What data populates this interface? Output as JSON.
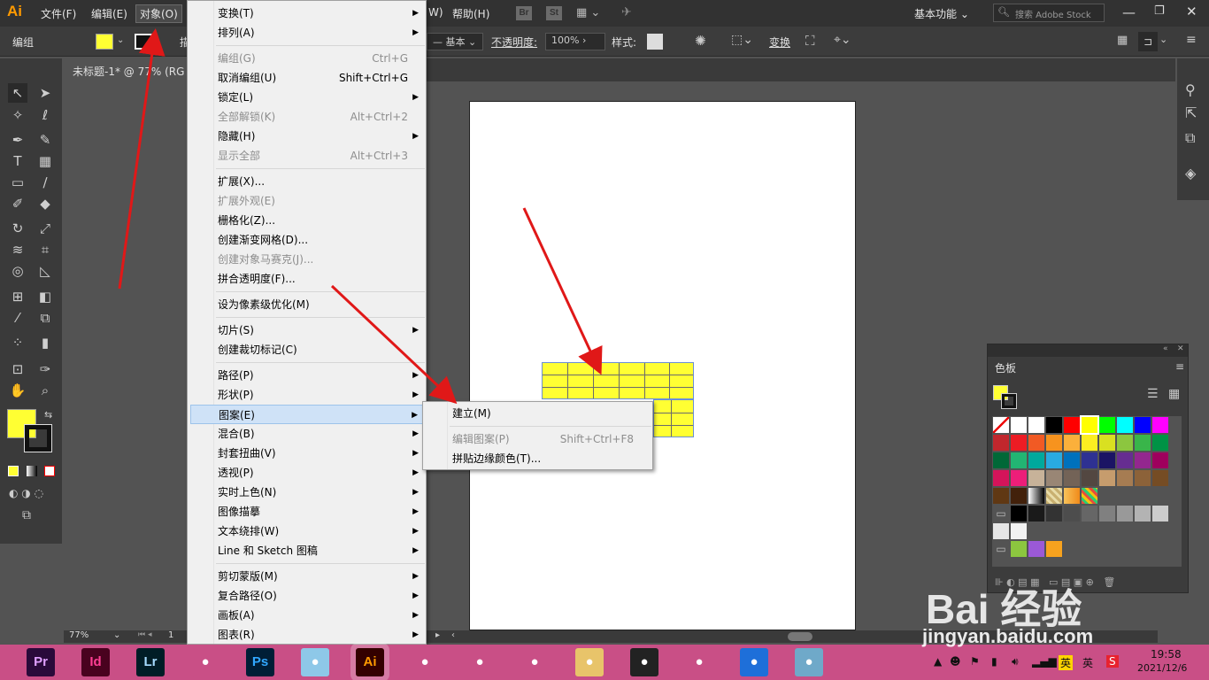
{
  "app": {
    "logo": "Ai"
  },
  "menubar": {
    "items": [
      "文件(F)",
      "编辑(E)",
      "对象(O)",
      "W)",
      "帮助(H)"
    ],
    "br": "Br",
    "st": "St",
    "workspace": "基本功能",
    "search_placeholder": "搜索 Adobe Stock"
  },
  "ctrlbar": {
    "group_label": "编组",
    "stroke_style": "基本",
    "opacity_label": "不透明度:",
    "opacity_value": "100%",
    "style_label": "样式:",
    "transform_label": "变换",
    "partial": "描"
  },
  "document": {
    "tab_title": "未标题-1* @ 77% (RG"
  },
  "status": {
    "zoom": "77%",
    "page": "1"
  },
  "object_menu": [
    {
      "label": "变换(T)",
      "shortcut": "",
      "arrow": true,
      "disabled": false
    },
    {
      "label": "排列(A)",
      "shortcut": "",
      "arrow": true,
      "disabled": false
    },
    {
      "sep": true
    },
    {
      "label": "编组(G)",
      "shortcut": "Ctrl+G",
      "arrow": false,
      "disabled": true
    },
    {
      "label": "取消编组(U)",
      "shortcut": "Shift+Ctrl+G",
      "arrow": false,
      "disabled": false
    },
    {
      "label": "锁定(L)",
      "shortcut": "",
      "arrow": true,
      "disabled": false
    },
    {
      "label": "全部解锁(K)",
      "shortcut": "Alt+Ctrl+2",
      "arrow": false,
      "disabled": true
    },
    {
      "label": "隐藏(H)",
      "shortcut": "",
      "arrow": true,
      "disabled": false
    },
    {
      "label": "显示全部",
      "shortcut": "Alt+Ctrl+3",
      "arrow": false,
      "disabled": true
    },
    {
      "sep": true
    },
    {
      "label": "扩展(X)...",
      "shortcut": "",
      "arrow": false,
      "disabled": false
    },
    {
      "label": "扩展外观(E)",
      "shortcut": "",
      "arrow": false,
      "disabled": true
    },
    {
      "label": "栅格化(Z)...",
      "shortcut": "",
      "arrow": false,
      "disabled": false
    },
    {
      "label": "创建渐变网格(D)...",
      "shortcut": "",
      "arrow": false,
      "disabled": false
    },
    {
      "label": "创建对象马赛克(J)...",
      "shortcut": "",
      "arrow": false,
      "disabled": true
    },
    {
      "label": "拼合透明度(F)...",
      "shortcut": "",
      "arrow": false,
      "disabled": false
    },
    {
      "sep": true
    },
    {
      "label": "设为像素级优化(M)",
      "shortcut": "",
      "arrow": false,
      "disabled": false
    },
    {
      "sep": true
    },
    {
      "label": "切片(S)",
      "shortcut": "",
      "arrow": true,
      "disabled": false
    },
    {
      "label": "创建裁切标记(C)",
      "shortcut": "",
      "arrow": false,
      "disabled": false
    },
    {
      "sep": true
    },
    {
      "label": "路径(P)",
      "shortcut": "",
      "arrow": true,
      "disabled": false
    },
    {
      "label": "形状(P)",
      "shortcut": "",
      "arrow": true,
      "disabled": false
    },
    {
      "label": "图案(E)",
      "shortcut": "",
      "arrow": true,
      "disabled": false,
      "highlighted": true
    },
    {
      "label": "混合(B)",
      "shortcut": "",
      "arrow": true,
      "disabled": false
    },
    {
      "label": "封套扭曲(V)",
      "shortcut": "",
      "arrow": true,
      "disabled": false
    },
    {
      "label": "透视(P)",
      "shortcut": "",
      "arrow": true,
      "disabled": false
    },
    {
      "label": "实时上色(N)",
      "shortcut": "",
      "arrow": true,
      "disabled": false
    },
    {
      "label": "图像描摹",
      "shortcut": "",
      "arrow": true,
      "disabled": false
    },
    {
      "label": "文本绕排(W)",
      "shortcut": "",
      "arrow": true,
      "disabled": false
    },
    {
      "label": "Line 和 Sketch 图稿",
      "shortcut": "",
      "arrow": true,
      "disabled": false
    },
    {
      "sep": true
    },
    {
      "label": "剪切蒙版(M)",
      "shortcut": "",
      "arrow": true,
      "disabled": false
    },
    {
      "label": "复合路径(O)",
      "shortcut": "",
      "arrow": true,
      "disabled": false
    },
    {
      "label": "画板(A)",
      "shortcut": "",
      "arrow": true,
      "disabled": false
    },
    {
      "label": "图表(R)",
      "shortcut": "",
      "arrow": true,
      "disabled": false
    }
  ],
  "pattern_submenu": [
    {
      "label": "建立(M)",
      "shortcut": "",
      "disabled": false
    },
    {
      "sep": true
    },
    {
      "label": "编辑图案(P)",
      "shortcut": "Shift+Ctrl+F8",
      "disabled": true
    },
    {
      "label": "拼贴边缘颜色(T)...",
      "shortcut": "",
      "disabled": false
    }
  ],
  "swatches_panel": {
    "title": "色板",
    "fill_color": "#ffff33",
    "rows": [
      [
        "none",
        "#ffffff",
        "#ffffff",
        "#000000",
        "#ff0000",
        "#ffff00",
        "#00ff00",
        "#00ffff",
        "#0000ff",
        "#ff00ff"
      ],
      [
        "#c1272d",
        "#ed1c24",
        "#f15a24",
        "#f7931e",
        "#fbb03b",
        "#fcee21",
        "#d9e021",
        "#8cc63f",
        "#39b54a",
        "#009245"
      ],
      [
        "#006837",
        "#22b573",
        "#00a99d",
        "#29abe2",
        "#0071bc",
        "#2e3192",
        "#1b1464",
        "#662d91",
        "#93278f",
        "#9e005d"
      ],
      [
        "#d4145a",
        "#ed1e79",
        "#c7b299",
        "#998675",
        "#736357",
        "#534741",
        "#c69c6d",
        "#a67c52",
        "#8c6239",
        "#754c24"
      ],
      [
        "#603813",
        "#42210b",
        "#gradient1",
        "#gradient2",
        "#gradient3",
        "#pattern1"
      ],
      [
        "folder",
        "#000000",
        "#1a1a1a",
        "#333333",
        "#4d4d4d",
        "#666666",
        "#808080",
        "#999999",
        "#b3b3b3",
        "#cccccc"
      ],
      [
        "#e6e6e6",
        "#f2f2f2"
      ],
      [
        "folder",
        "#8cc63f",
        "#9b59d6",
        "#f7a21e"
      ]
    ]
  },
  "taskbar": {
    "apps": [
      {
        "label": "Pr",
        "bg": "#2a0a3a",
        "fg": "#e0a0ff"
      },
      {
        "label": "Id",
        "bg": "#49021f",
        "fg": "#ff3f94"
      },
      {
        "label": "Lr",
        "bg": "#001d26",
        "fg": "#a6dcff"
      },
      {
        "label": "",
        "bg": "#c94f86",
        "fg": "#fff"
      },
      {
        "label": "Ps",
        "bg": "#001e36",
        "fg": "#31a8ff"
      },
      {
        "label": "",
        "bg": "#8ec8e8",
        "fg": "#fff"
      },
      {
        "label": "Ai",
        "bg": "#330000",
        "fg": "#ff9a00"
      },
      {
        "label": "",
        "bg": "#c94f86",
        "fg": "#fff"
      },
      {
        "label": "",
        "bg": "#c94f86",
        "fg": "#fff"
      },
      {
        "label": "",
        "bg": "#c94f86",
        "fg": "#fff"
      },
      {
        "label": "",
        "bg": "#e8c46a",
        "fg": "#fff"
      },
      {
        "label": "",
        "bg": "#222222",
        "fg": "#fff"
      },
      {
        "label": "",
        "bg": "#c94f86",
        "fg": "#fff"
      },
      {
        "label": "",
        "bg": "#1e6fd9",
        "fg": "#fff"
      },
      {
        "label": "",
        "bg": "#6fa9c9",
        "fg": "#fff"
      }
    ],
    "ime": "英",
    "ime2": "英",
    "time": "19:58",
    "date": "2021/12/6"
  },
  "watermark": {
    "brand": "Bai 经验",
    "url": "jingyan.baidu.com"
  }
}
